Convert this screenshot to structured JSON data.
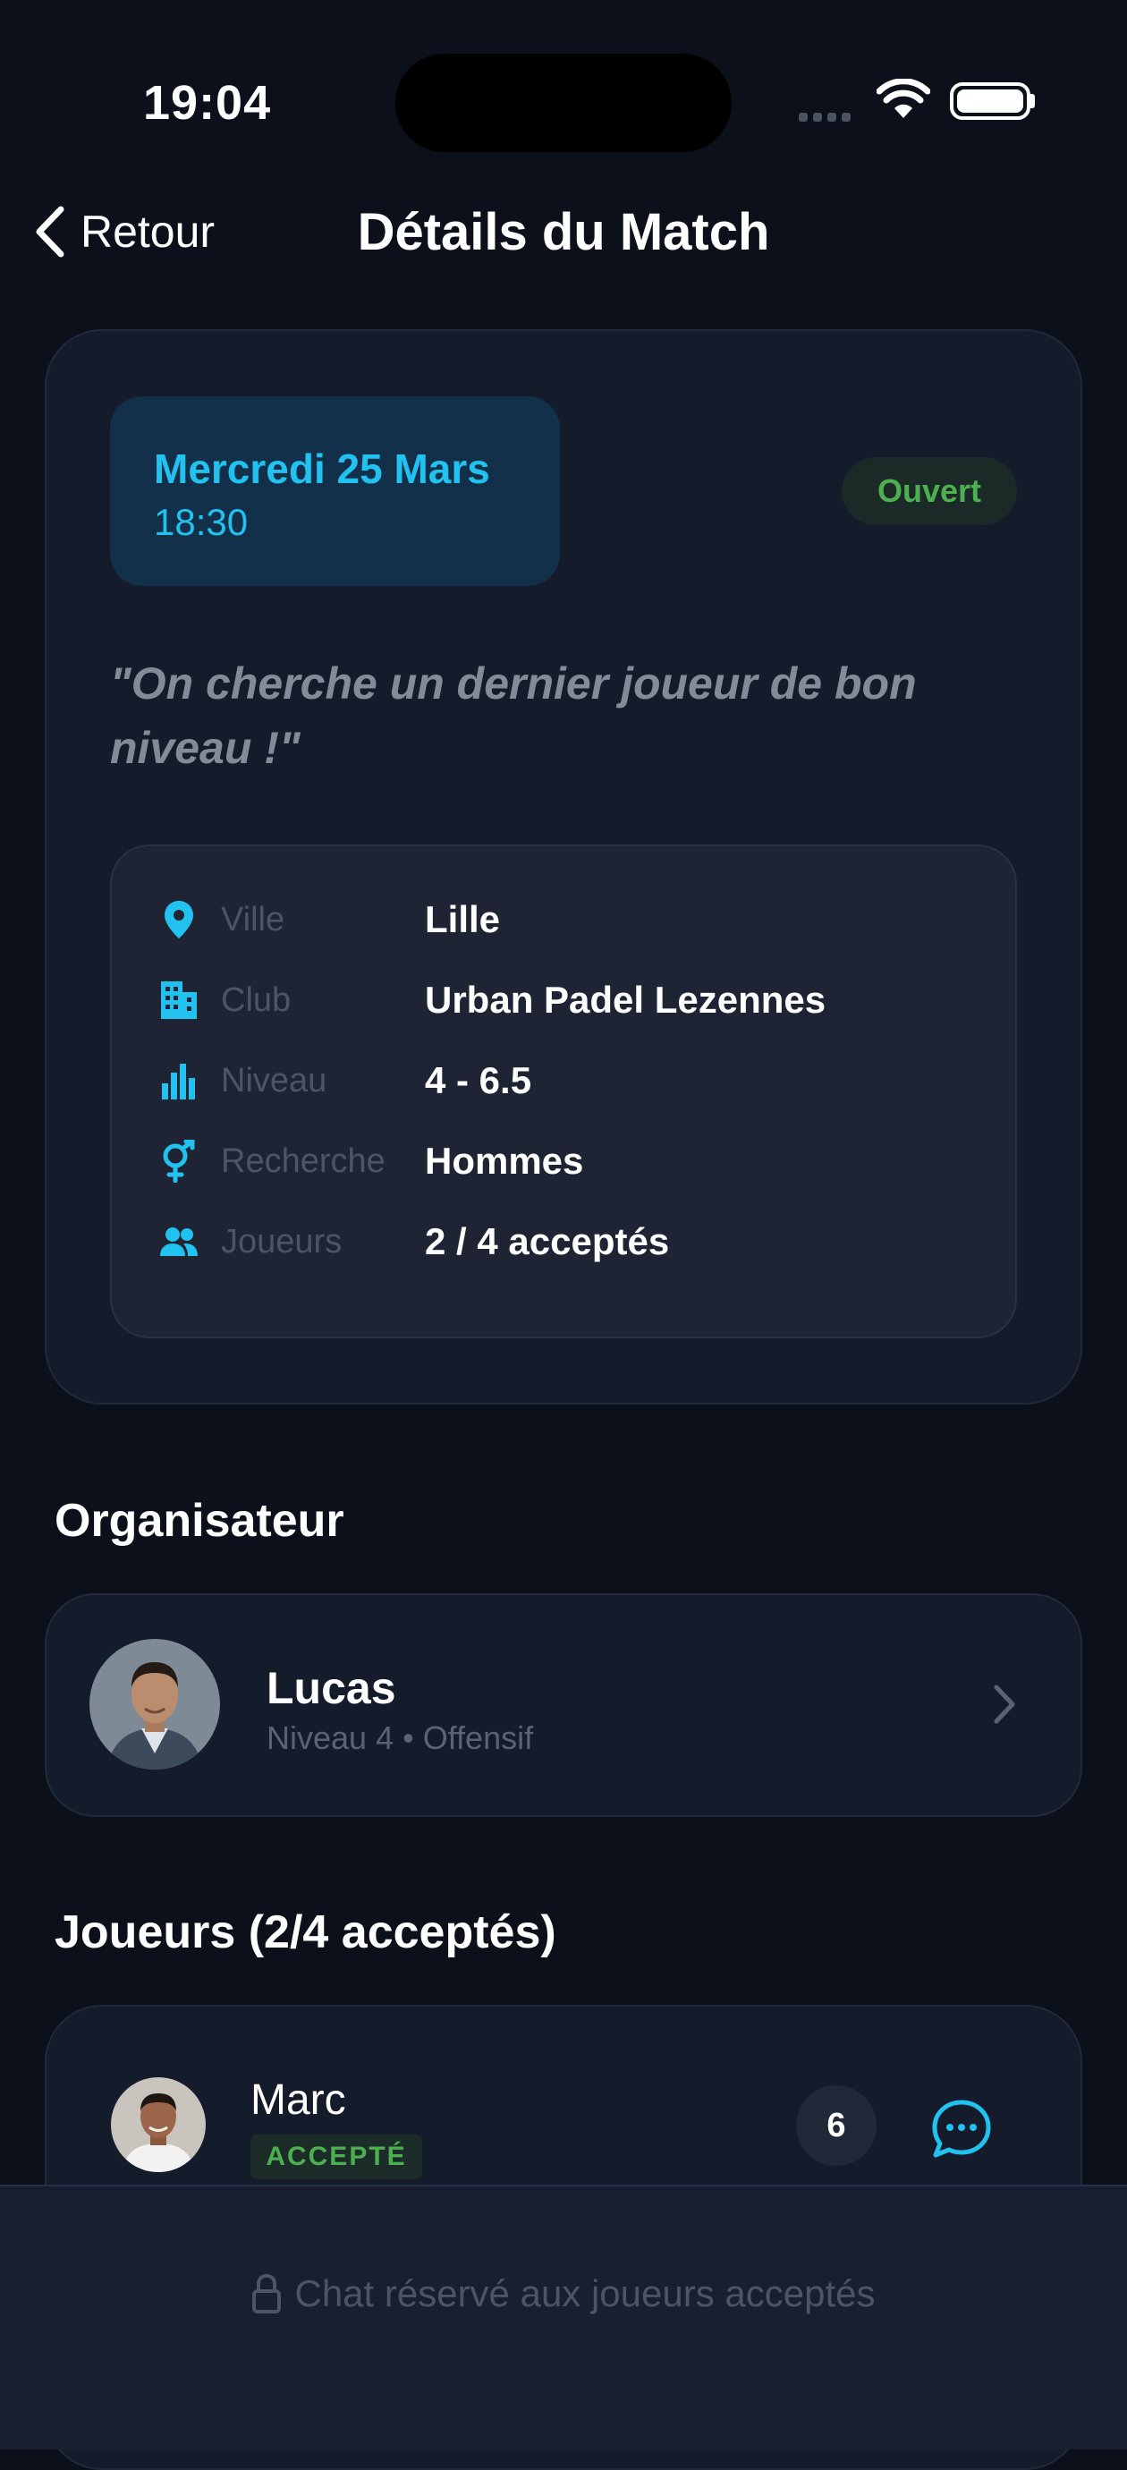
{
  "status_bar": {
    "time": "19:04"
  },
  "nav": {
    "back_label": "Retour",
    "title": "Détails du Match"
  },
  "match": {
    "date": "Mercredi 25 Mars",
    "time": "18:30",
    "status": "Ouvert",
    "quote": "\"On cherche un dernier joueur de bon niveau !\"",
    "details": [
      {
        "icon": "location-pin-icon",
        "label": "Ville",
        "value": "Lille"
      },
      {
        "icon": "building-icon",
        "label": "Club",
        "value": "Urban Padel Lezennes"
      },
      {
        "icon": "bar-chart-icon",
        "label": "Niveau",
        "value": "4 - 6.5"
      },
      {
        "icon": "gender-icon",
        "label": "Recherche",
        "value": "Hommes"
      },
      {
        "icon": "people-icon",
        "label": "Joueurs",
        "value": "2 / 4 acceptés"
      }
    ]
  },
  "organizer": {
    "section_title": "Organisateur",
    "name": "Lucas",
    "subtitle": "Niveau 4 • Offensif"
  },
  "players": {
    "section_title": "Joueurs (2/4 acceptés)",
    "items": [
      {
        "name": "Marc",
        "status": "ACCEPTÉ",
        "level": "6"
      }
    ]
  },
  "footer": {
    "chat_notice": "Chat réservé aux joueurs acceptés"
  },
  "colors": {
    "accent": "#22c2f0",
    "success": "#4caf50",
    "background": "#0b101b",
    "card": "#141b2a"
  }
}
